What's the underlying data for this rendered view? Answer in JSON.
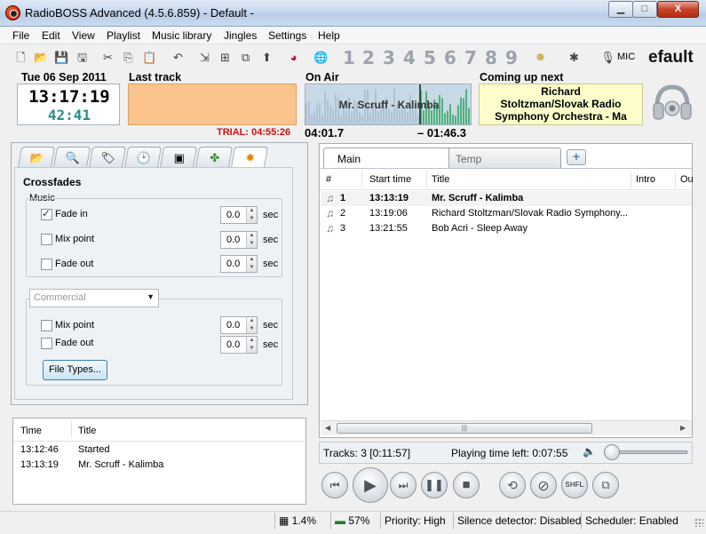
{
  "window": {
    "title": "RadioBOSS Advanced (4.5.6.859) - Default -",
    "minimize_label": "▁",
    "maximize_label": "□",
    "close_label": "X"
  },
  "menu": [
    "File",
    "Edit",
    "View",
    "Playlist",
    "Music library",
    "Jingles",
    "Settings",
    "Help"
  ],
  "toolbar": {
    "jingle_numbers": [
      "1",
      "2",
      "3",
      "4",
      "5",
      "6",
      "7",
      "8",
      "9"
    ],
    "mic_label": "MIC",
    "playlist_name": "efault"
  },
  "info": {
    "date": "Tue 06 Sep 2011",
    "time": "13:17:19",
    "time_sub": "42:41",
    "last_track_label": "Last track",
    "trial": "TRIAL: 04:55:26",
    "on_air_label": "On Air",
    "on_air_title": "Mr. Scruff - Kalimba",
    "elapsed": "04:01.7",
    "remaining": "– 01:46.3",
    "coming_up_label": "Coming up next",
    "coming_up_lines": [
      "Richard",
      "Stoltzman/Slovak Radio",
      "Symphony Orchestra - Ma"
    ]
  },
  "crossfades": {
    "title": "Crossfades",
    "music_group": "Music",
    "music_rows": [
      {
        "label": "Fade in",
        "checked": true,
        "value": "0.0",
        "unit": "sec"
      },
      {
        "label": "Mix point",
        "checked": false,
        "value": "0.0",
        "unit": "sec"
      },
      {
        "label": "Fade out",
        "checked": false,
        "value": "0.0",
        "unit": "sec"
      }
    ],
    "category_combo": "Commercial",
    "commercial_rows": [
      {
        "label": "Mix point",
        "checked": false,
        "value": "0.0",
        "unit": "sec"
      },
      {
        "label": "Fade out",
        "checked": false,
        "value": "0.0",
        "unit": "sec"
      }
    ],
    "file_types_button": "File Types..."
  },
  "history": {
    "columns": [
      "Time",
      "Title"
    ],
    "rows": [
      {
        "time": "13:12:46",
        "title": "Started"
      },
      {
        "time": "13:13:19",
        "title": "Mr. Scruff - Kalimba"
      }
    ]
  },
  "playlist": {
    "tabs": [
      "Main",
      "Temp"
    ],
    "add_tab_label": "+",
    "columns": [
      "#",
      "Start time",
      "Title",
      "Intro",
      "Ou"
    ],
    "rows": [
      {
        "num": "1",
        "start": "13:13:19",
        "title": "Mr. Scruff - Kalimba",
        "current": true
      },
      {
        "num": "2",
        "start": "13:19:06",
        "title": "Richard Stoltzman/Slovak Radio Symphony...",
        "current": false
      },
      {
        "num": "3",
        "start": "13:21:55",
        "title": "Bob Acri - Sleep Away",
        "current": false
      }
    ],
    "tracks": "Tracks: 3 [0:11:57]",
    "playing_time_left": "Playing time left: 0:07:55",
    "volume_level": 0.05
  },
  "controls": {
    "shuffle_label": "SHFL"
  },
  "statusbar": {
    "cpu": "1.4%",
    "memory": "57%",
    "priority": "Priority: High",
    "silence": "Silence detector: Disabled",
    "scheduler": "Scheduler: Enabled"
  }
}
